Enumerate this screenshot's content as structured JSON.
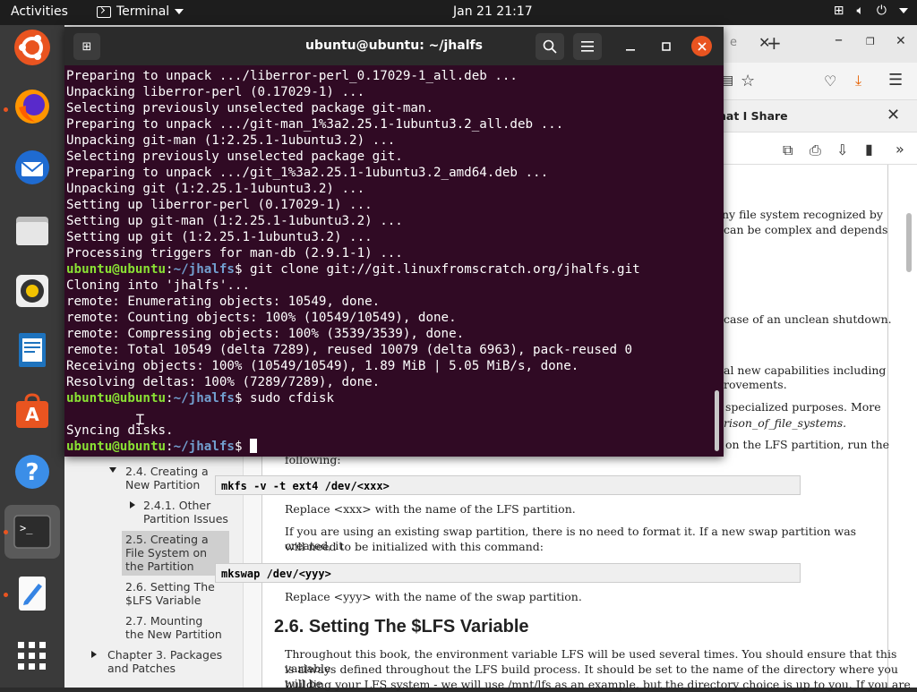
{
  "topbar": {
    "activities": "Activities",
    "app_name": "Terminal",
    "clock": "Jan 21  21:17"
  },
  "terminal": {
    "title": "ubuntu@ubuntu: ~/jhalfs",
    "lines": [
      {
        "text": "Preparing to unpack .../liberror-perl_0.17029-1_all.deb ..."
      },
      {
        "text": "Unpacking liberror-perl (0.17029-1) ..."
      },
      {
        "text": "Selecting previously unselected package git-man."
      },
      {
        "text": "Preparing to unpack .../git-man_1%3a2.25.1-1ubuntu3.2_all.deb ..."
      },
      {
        "text": "Unpacking git-man (1:2.25.1-1ubuntu3.2) ..."
      },
      {
        "text": "Selecting previously unselected package git."
      },
      {
        "text": "Preparing to unpack .../git_1%3a2.25.1-1ubuntu3.2_amd64.deb ..."
      },
      {
        "text": "Unpacking git (1:2.25.1-1ubuntu3.2) ..."
      },
      {
        "text": "Setting up liberror-perl (0.17029-1) ..."
      },
      {
        "text": "Setting up git-man (1:2.25.1-1ubuntu3.2) ..."
      },
      {
        "text": "Setting up git (1:2.25.1-1ubuntu3.2) ..."
      },
      {
        "text": "Processing triggers for man-db (2.9.1-1) ..."
      },
      {
        "user": "ubuntu@ubuntu",
        "path": "~/jhalfs",
        "cmd": " git clone git://git.linuxfromscratch.org/jhalfs.git"
      },
      {
        "text": "Cloning into 'jhalfs'..."
      },
      {
        "text": "remote: Enumerating objects: 10549, done."
      },
      {
        "text": "remote: Counting objects: 100% (10549/10549), done."
      },
      {
        "text": "remote: Compressing objects: 100% (3539/3539), done."
      },
      {
        "text": "remote: Total 10549 (delta 7289), reused 10079 (delta 6963), pack-reused 0"
      },
      {
        "text": "Receiving objects: 100% (10549/10549), 1.89 MiB | 5.05 MiB/s, done."
      },
      {
        "text": "Resolving deltas: 100% (7289/7289), done."
      },
      {
        "user": "ubuntu@ubuntu",
        "path": "~/jhalfs",
        "cmd": " sudo cfdisk"
      },
      {
        "text": ""
      },
      {
        "text": "Syncing disks."
      },
      {
        "user": "ubuntu@ubuntu",
        "path": "~/jhalfs",
        "cmd": " ",
        "cursor": true
      }
    ]
  },
  "firefox": {
    "tab_partial": "e",
    "notif_text": "hat I Share",
    "toc": [
      {
        "label": "2.4. Creating a New Partition",
        "tri": "down"
      },
      {
        "label": "2.4.1. Other Partition Issues",
        "tri": "right"
      },
      {
        "label": "2.5. Creating a File System on the Partition",
        "selected": true
      },
      {
        "label": "2.6. Setting The $LFS Variable"
      },
      {
        "label": "2.7. Mounting the New Partition"
      },
      {
        "label": "Chapter 3. Packages and Patches",
        "tri": "right"
      }
    ],
    "doc": {
      "frag1": "ny file system recognized by",
      "frag2": "can be complex and depends",
      "frag3": "case of an unclean shutdown.",
      "frag4": "al new capabilities including",
      "frag5": "rovements.",
      "frag6": "specialized purposes. More",
      "frag7": "rison_of_file_systems.",
      "frag8": "on the LFS partition, run the",
      "frag9": "following:",
      "code1": "mkfs -v -t ext4 /dev/<xxx>",
      "p1": "Replace <xxx> with the name of the LFS partition.",
      "p2a": "If you are using an existing swap  partition, there is no need to format it. If a new  swap partition was created, it",
      "p2b": "will need to be initialized with this command:",
      "code2": "mkswap /dev/<yyy>",
      "p3": "Replace <yyy> with the name of the swap partition.",
      "h2": "2.6. Setting The $LFS Variable",
      "p4a": "Throughout this book, the environment variable LFS will be used several times. You should ensure that this variable",
      "p4b": "is always defined throughout the LFS build process. It should be set to the name of the directory where you will be",
      "p4c": "building your LFS system - we will use /mnt/lfs as an example, but the directory choice is up to you. If you are"
    }
  }
}
